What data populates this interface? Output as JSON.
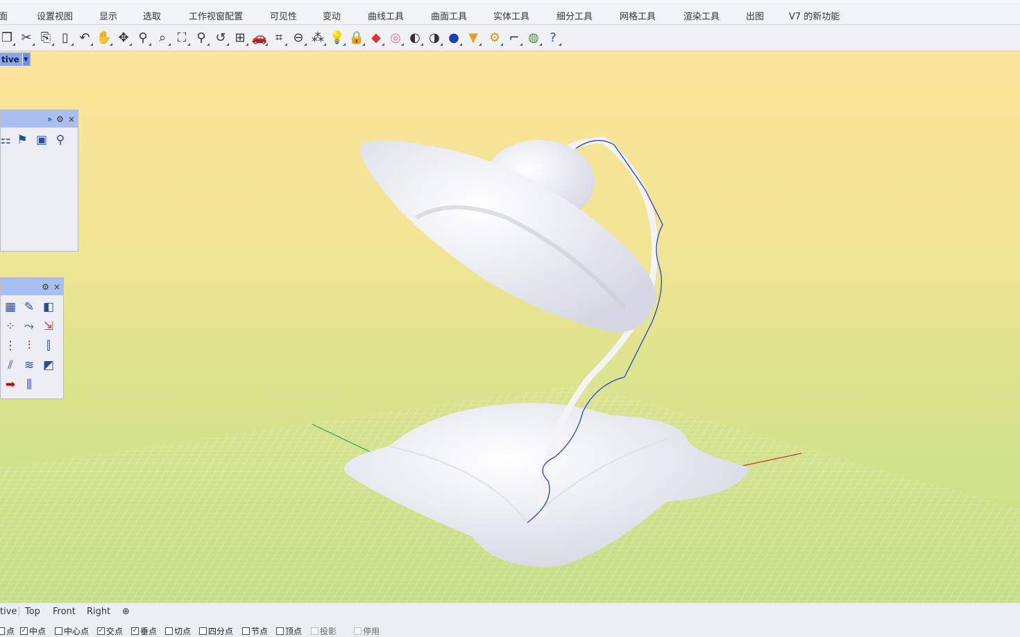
{
  "menu": [
    "面",
    "设置视图",
    "显示",
    "选取",
    "工作视窗配置",
    "可见性",
    "变动",
    "曲线工具",
    "曲面工具",
    "实体工具",
    "细分工具",
    "网格工具",
    "渲染工具",
    "出图",
    "V7 的新功能"
  ],
  "toolbar_icons": [
    "new-icon",
    "cut-icon",
    "copy-icon",
    "paste-icon",
    "undo-icon",
    "pan-hand-icon",
    "rotate-view-icon",
    "zoom-icon",
    "zoom-window-icon",
    "zoom-extents-icon",
    "zoom-selected-icon",
    "undo-view-icon",
    "four-viewports-icon",
    "car-named-view-icon",
    "named-cplane-icon",
    "cplane-icon",
    "points-icon",
    "light-icon",
    "lock-icon",
    "layer-icon",
    "color-wheel-icon",
    "shaded-sphere-icon",
    "rendered-sphere-icon",
    "blue-sphere-icon",
    "ghosted-cone-icon",
    "options-gear-icon",
    "dimension-icon",
    "sync-icon",
    "help-icon"
  ],
  "viewport": {
    "active_label": "tive"
  },
  "panel1": {
    "header_icons": [
      "»",
      "⚙",
      "×"
    ]
  },
  "panel2": {
    "header_icons": [
      "⚙",
      "×"
    ]
  },
  "viewport_tabs": [
    "tive",
    "Top",
    "Front",
    "Right",
    "⊕"
  ],
  "osnaps": [
    {
      "label": "点",
      "checked": false,
      "enabled": true
    },
    {
      "label": "中点",
      "checked": true,
      "enabled": true
    },
    {
      "label": "中心点",
      "checked": false,
      "enabled": true
    },
    {
      "label": "交点",
      "checked": true,
      "enabled": true
    },
    {
      "label": "垂点",
      "checked": true,
      "enabled": true
    },
    {
      "label": "切点",
      "checked": false,
      "enabled": true
    },
    {
      "label": "四分点",
      "checked": false,
      "enabled": true
    },
    {
      "label": "节点",
      "checked": false,
      "enabled": true
    },
    {
      "label": "顶点",
      "checked": false,
      "enabled": true
    },
    {
      "label": "投影",
      "checked": false,
      "enabled": false
    },
    {
      "label": "停用",
      "checked": false,
      "enabled": false
    }
  ],
  "colors": {
    "viewport_top": "#fce39a",
    "viewport_bottom": "#c5df86",
    "panel_header": "#a9bff2",
    "active_tab": "#8aa6ee",
    "curve": "#2a3fd0"
  }
}
